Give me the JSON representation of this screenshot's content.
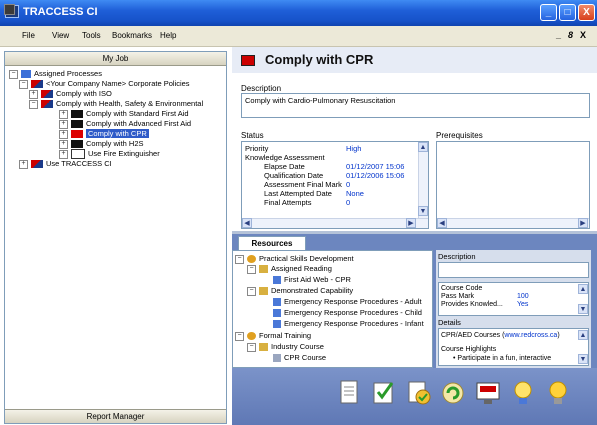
{
  "window": {
    "title": "TRACCESS CI",
    "controls": [
      "_",
      "□",
      "X"
    ]
  },
  "menu": {
    "items": [
      "File",
      "View",
      "Tools",
      "Bookmarks",
      "Help"
    ],
    "mdi": [
      "_",
      "8",
      "X"
    ]
  },
  "left_panel": {
    "header": "My Job",
    "footer": "Report Manager",
    "tree": [
      {
        "label": "Assigned Processes",
        "expander": "−"
      },
      {
        "label": "<Your Company Name> Corporate Policies",
        "expander": "−"
      },
      {
        "label": "Comply with ISO",
        "expander": "+"
      },
      {
        "label": "Comply with Health, Safety & Environmental",
        "expander": "−"
      },
      {
        "label": "Comply with Standard First Aid",
        "expander": "+"
      },
      {
        "label": "Comply with Advanced First Aid",
        "expander": "+"
      },
      {
        "label": "Comply with CPR",
        "expander": "+"
      },
      {
        "label": "Comply with H2S",
        "expander": "+"
      },
      {
        "label": "Use Fire Extinguisher",
        "expander": "+"
      },
      {
        "label": "Use TRACCESS CI",
        "expander": "+"
      }
    ]
  },
  "detail": {
    "title": "Comply with CPR",
    "description_label": "Description",
    "description": "Comply with Cardio-Pulmonary Resuscitation",
    "status_label": "Status",
    "prereq_label": "Prerequisites",
    "status": [
      {
        "key": "Priority",
        "value": "High"
      },
      {
        "key": "Knowledge Assessment",
        "value": ""
      },
      {
        "key": "Elapse Date",
        "value": "01/12/2007 15:06"
      },
      {
        "key": "Qualification Date",
        "value": "01/12/2006 15:06"
      },
      {
        "key": "Assessment Final Mark",
        "value": "0"
      },
      {
        "key": "Last Attempted Date",
        "value": "None"
      },
      {
        "key": "Final Attempts",
        "value": "0"
      }
    ]
  },
  "resources": {
    "tab": "Resources",
    "tree": [
      "Practical Skills Development",
      "Assigned Reading",
      "First Aid Web - CPR",
      "Demonstrated Capability",
      "Emergency Response Procedures - Adult",
      "Emergency Response Procedures - Child",
      "Emergency Response Procedures - Infant",
      "Formal Training",
      "Industry Course",
      "CPR Course"
    ],
    "description_label": "Description",
    "props": [
      {
        "key": "Course Code",
        "value": ""
      },
      {
        "key": "Pass Mark",
        "value": "100"
      },
      {
        "key": "Provides Knowled...",
        "value": "Yes"
      }
    ],
    "details_label": "Details",
    "details_line1": "CPR/AED Courses (",
    "details_link": "www.redcross.ca",
    "details_line1_end": ")",
    "highlights_label": "Course Highlights",
    "highlight_item": "Participate in a fun, interactive"
  },
  "colors": {
    "titlebar": "#1f5fd8",
    "selection": "#2f5bc8",
    "link": "#0033cc",
    "resources_bg": "#6c86bf"
  }
}
